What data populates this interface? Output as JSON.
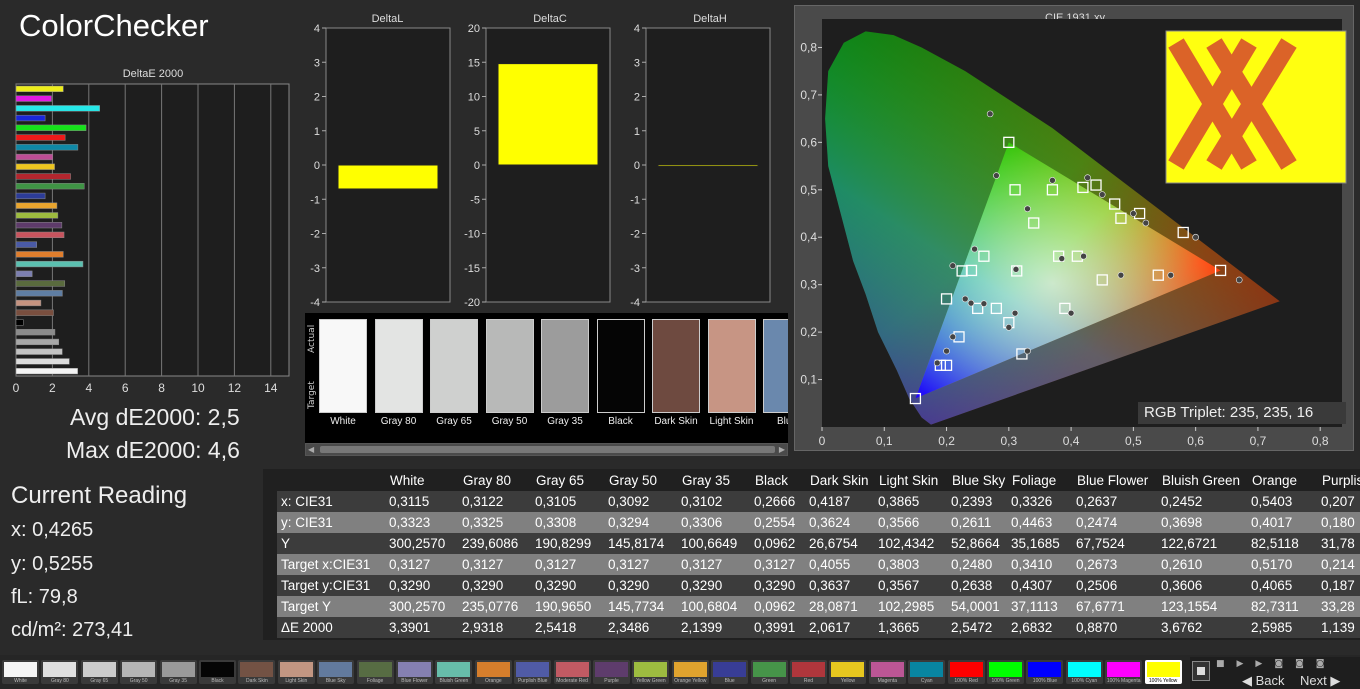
{
  "app_title": "ColorChecker",
  "de2000": {
    "title": "DeltaE 2000",
    "xlim": [
      0,
      15
    ],
    "ticks": [
      "0",
      "2",
      "4",
      "6",
      "8",
      "10",
      "12",
      "14"
    ],
    "bars": [
      {
        "color": "#f4f4f4",
        "v": 3.39
      },
      {
        "color": "#dcdcdc",
        "v": 2.93
      },
      {
        "color": "#c3c3c3",
        "v": 2.54
      },
      {
        "color": "#a8a8a8",
        "v": 2.35
      },
      {
        "color": "#8c8c8c",
        "v": 2.14
      },
      {
        "color": "#000000",
        "v": 0.4
      },
      {
        "color": "#7a4f3f",
        "v": 2.06
      },
      {
        "color": "#c59380",
        "v": 1.37
      },
      {
        "color": "#5f7ea3",
        "v": 2.55
      },
      {
        "color": "#5a6b3e",
        "v": 2.68
      },
      {
        "color": "#7c7fb0",
        "v": 0.89
      },
      {
        "color": "#5bc0b0",
        "v": 3.68
      },
      {
        "color": "#e07e2d",
        "v": 2.6
      },
      {
        "color": "#4a5aa6",
        "v": 1.14
      },
      {
        "color": "#c8545e",
        "v": 2.64
      },
      {
        "color": "#5e3b6a",
        "v": 2.52
      },
      {
        "color": "#9dbb3f",
        "v": 2.3
      },
      {
        "color": "#e9a52e",
        "v": 2.25
      },
      {
        "color": "#2c3c98",
        "v": 1.6
      },
      {
        "color": "#3f9445",
        "v": 3.75
      },
      {
        "color": "#b3262e",
        "v": 3.0
      },
      {
        "color": "#ecc51f",
        "v": 2.12
      },
      {
        "color": "#be4d95",
        "v": 2.02
      },
      {
        "color": "#0f88a6",
        "v": 3.4
      },
      {
        "color": "#ee1a1a",
        "v": 2.7
      },
      {
        "color": "#16e21a",
        "v": 3.85
      },
      {
        "color": "#1a27d9",
        "v": 1.6
      },
      {
        "color": "#26e8e8",
        "v": 4.6
      },
      {
        "color": "#e21ae2",
        "v": 1.95
      },
      {
        "color": "#eded1c",
        "v": 2.6
      }
    ]
  },
  "stats": {
    "avg": "Avg dE2000: 2,5",
    "max": "Max dE2000: 4,6"
  },
  "current": {
    "title": "Current Reading",
    "x": "x: 0,4265",
    "y": "y: 0,5255",
    "fl": "fL: 79,8",
    "cd": "cd/m²: 273,41"
  },
  "delta_l": {
    "title": "DeltaL",
    "ticks": [
      "4",
      "3",
      "2",
      "1",
      "0",
      "-1",
      "-2",
      "-3",
      "-4"
    ],
    "ylim": [
      -4,
      4
    ],
    "value": -0.7
  },
  "delta_c": {
    "title": "DeltaC",
    "ticks": [
      "20",
      "15",
      "10",
      "5",
      "0",
      "-5",
      "-10",
      "-15",
      "-20"
    ],
    "ylim": [
      -20,
      20
    ],
    "value": 14.8
  },
  "delta_h": {
    "title": "DeltaH",
    "ticks": [
      "4",
      "3",
      "2",
      "1",
      "0",
      "-1",
      "-2",
      "-3",
      "-4"
    ],
    "ylim": [
      -4,
      4
    ],
    "value": 0.0
  },
  "patches": {
    "side_actual": "Actual",
    "side_target": "Target",
    "items": [
      {
        "name": "White",
        "a": "#f8f8f8",
        "t": "#f8f8f8"
      },
      {
        "name": "Gray 80",
        "a": "#e3e4e3",
        "t": "#e3e4e3"
      },
      {
        "name": "Gray 65",
        "a": "#cfd0cf",
        "t": "#cfd0cf"
      },
      {
        "name": "Gray 50",
        "a": "#b8b9b8",
        "t": "#b8b9b8"
      },
      {
        "name": "Gray 35",
        "a": "#9c9c9c",
        "t": "#9c9c9c"
      },
      {
        "name": "Black",
        "a": "#050505",
        "t": "#050505"
      },
      {
        "name": "Dark Skin",
        "a": "#6e4a40",
        "t": "#6e4a40"
      },
      {
        "name": "Light Skin",
        "a": "#c79584",
        "t": "#c79584"
      },
      {
        "name": "Blue",
        "a": "#6a88ad",
        "t": "#6a88ad"
      }
    ]
  },
  "cie": {
    "title": "CIE 1931 xy",
    "x_ticks": [
      "0",
      "0,1",
      "0,2",
      "0,3",
      "0,4",
      "0,5",
      "0,6",
      "0,7",
      "0,8"
    ],
    "y_ticks": [
      "0,8",
      "0,7",
      "0,6",
      "0,5",
      "0,4",
      "0,3",
      "0,2",
      "0,1"
    ],
    "rgb_triplet": "RGB Triplet: 235, 235, 16",
    "gamut": {
      "r": [
        0.64,
        0.33
      ],
      "g": [
        0.3,
        0.6
      ],
      "b": [
        0.15,
        0.06
      ]
    },
    "targets": [
      [
        0.3127,
        0.329
      ],
      [
        0.64,
        0.33
      ],
      [
        0.3,
        0.6
      ],
      [
        0.15,
        0.06
      ],
      [
        0.225,
        0.329
      ],
      [
        0.321,
        0.154
      ],
      [
        0.419,
        0.505
      ],
      [
        0.2,
        0.27
      ],
      [
        0.26,
        0.36
      ],
      [
        0.38,
        0.36
      ],
      [
        0.44,
        0.51
      ],
      [
        0.48,
        0.44
      ],
      [
        0.54,
        0.32
      ],
      [
        0.58,
        0.41
      ],
      [
        0.25,
        0.25
      ],
      [
        0.22,
        0.19
      ],
      [
        0.19,
        0.13
      ],
      [
        0.47,
        0.47
      ],
      [
        0.41,
        0.36
      ],
      [
        0.31,
        0.5
      ],
      [
        0.34,
        0.43
      ],
      [
        0.37,
        0.5
      ],
      [
        0.51,
        0.45
      ],
      [
        0.24,
        0.33
      ],
      [
        0.2,
        0.13
      ],
      [
        0.28,
        0.25
      ],
      [
        0.39,
        0.25
      ],
      [
        0.3,
        0.22
      ],
      [
        0.45,
        0.31
      ]
    ],
    "measured": [
      [
        0.3115,
        0.3323
      ],
      [
        0.67,
        0.31
      ],
      [
        0.27,
        0.66
      ],
      [
        0.185,
        0.135
      ],
      [
        0.2393,
        0.2611
      ],
      [
        0.33,
        0.16
      ],
      [
        0.4265,
        0.5255
      ],
      [
        0.21,
        0.34
      ],
      [
        0.245,
        0.375
      ],
      [
        0.385,
        0.355
      ],
      [
        0.45,
        0.49
      ],
      [
        0.5,
        0.45
      ],
      [
        0.56,
        0.32
      ],
      [
        0.6,
        0.4
      ],
      [
        0.26,
        0.26
      ],
      [
        0.21,
        0.19
      ],
      [
        0.2,
        0.16
      ],
      [
        0.42,
        0.36
      ],
      [
        0.33,
        0.46
      ],
      [
        0.28,
        0.53
      ],
      [
        0.37,
        0.52
      ],
      [
        0.52,
        0.43
      ],
      [
        0.31,
        0.24
      ],
      [
        0.4,
        0.24
      ],
      [
        0.48,
        0.32
      ],
      [
        0.23,
        0.27
      ],
      [
        0.3,
        0.21
      ]
    ]
  },
  "table": {
    "columns": [
      "White",
      "Gray 80",
      "Gray 65",
      "Gray 50",
      "Gray 35",
      "Black",
      "Dark Skin",
      "Light Skin",
      "Blue Sky",
      "Foliage",
      "Blue Flower",
      "Bluish Green",
      "Orange",
      "Purplis"
    ],
    "rows": [
      {
        "h": "x: CIE31",
        "v": [
          "0,3115",
          "0,3122",
          "0,3105",
          "0,3092",
          "0,3102",
          "0,2666",
          "0,4187",
          "0,3865",
          "0,2393",
          "0,3326",
          "0,2637",
          "0,2452",
          "0,5403",
          "0,207"
        ]
      },
      {
        "h": "y: CIE31",
        "v": [
          "0,3323",
          "0,3325",
          "0,3308",
          "0,3294",
          "0,3306",
          "0,2554",
          "0,3624",
          "0,3566",
          "0,2611",
          "0,4463",
          "0,2474",
          "0,3698",
          "0,4017",
          "0,180"
        ]
      },
      {
        "h": "Y",
        "v": [
          "300,2570",
          "239,6086",
          "190,8299",
          "145,8174",
          "100,6649",
          "0,0962",
          "26,6754",
          "102,4342",
          "52,8664",
          "35,1685",
          "67,7524",
          "122,6721",
          "82,5118",
          "31,78"
        ]
      },
      {
        "h": "Target x:CIE31",
        "v": [
          "0,3127",
          "0,3127",
          "0,3127",
          "0,3127",
          "0,3127",
          "0,3127",
          "0,4055",
          "0,3803",
          "0,2480",
          "0,3410",
          "0,2673",
          "0,2610",
          "0,5170",
          "0,214"
        ]
      },
      {
        "h": "Target y:CIE31",
        "v": [
          "0,3290",
          "0,3290",
          "0,3290",
          "0,3290",
          "0,3290",
          "0,3290",
          "0,3637",
          "0,3567",
          "0,2638",
          "0,4307",
          "0,2506",
          "0,3606",
          "0,4065",
          "0,187"
        ]
      },
      {
        "h": "Target Y",
        "v": [
          "300,2570",
          "235,0776",
          "190,9650",
          "145,7734",
          "100,6804",
          "0,0962",
          "28,0871",
          "102,2985",
          "54,0001",
          "37,1113",
          "67,6771",
          "123,1554",
          "82,7311",
          "33,28"
        ]
      },
      {
        "h": "ΔE 2000",
        "v": [
          "3,3901",
          "2,9318",
          "2,5418",
          "2,3486",
          "2,1399",
          "0,3991",
          "2,0617",
          "1,3665",
          "2,5472",
          "2,6832",
          "0,8870",
          "3,6762",
          "2,5985",
          "1,139"
        ]
      }
    ]
  },
  "swatches": [
    {
      "label": "White",
      "color": "#f5f5f5"
    },
    {
      "label": "Gray 80",
      "color": "#e0e0e0"
    },
    {
      "label": "Gray 65",
      "color": "#cccccc"
    },
    {
      "label": "Gray 50",
      "color": "#b5b5b5"
    },
    {
      "label": "Gray 35",
      "color": "#9a9a9a"
    },
    {
      "label": "Black",
      "color": "#050505"
    },
    {
      "label": "Dark Skin",
      "color": "#735244"
    },
    {
      "label": "Light Skin",
      "color": "#c29682"
    },
    {
      "label": "Blue Sky",
      "color": "#627a9d"
    },
    {
      "label": "Foliage",
      "color": "#576c43"
    },
    {
      "label": "Blue Flower",
      "color": "#8580b1"
    },
    {
      "label": "Bluish Green",
      "color": "#67bdaa"
    },
    {
      "label": "Orange",
      "color": "#d67e2c"
    },
    {
      "label": "Purplish Blue",
      "color": "#505ba6"
    },
    {
      "label": "Moderate Red",
      "color": "#c15a63"
    },
    {
      "label": "Purple",
      "color": "#5e3c6c"
    },
    {
      "label": "Yellow Green",
      "color": "#9dbc40"
    },
    {
      "label": "Orange Yellow",
      "color": "#e0a32e"
    },
    {
      "label": "Blue",
      "color": "#383d96"
    },
    {
      "label": "Green",
      "color": "#469449"
    },
    {
      "label": "Red",
      "color": "#af363c"
    },
    {
      "label": "Yellow",
      "color": "#e7c71f"
    },
    {
      "label": "Magenta",
      "color": "#bb5695"
    },
    {
      "label": "Cyan",
      "color": "#0885a1"
    },
    {
      "label": "100% Red",
      "color": "#ff0000"
    },
    {
      "label": "100% Green",
      "color": "#00ff00"
    },
    {
      "label": "100% Blue",
      "color": "#0000ff"
    },
    {
      "label": "100% Cyan",
      "color": "#00ffff"
    },
    {
      "label": "100% Magenta",
      "color": "#ff00ff"
    },
    {
      "label": "100% Yellow",
      "color": "#ffff00"
    }
  ],
  "nav": {
    "back": "Back",
    "next": "Next"
  }
}
